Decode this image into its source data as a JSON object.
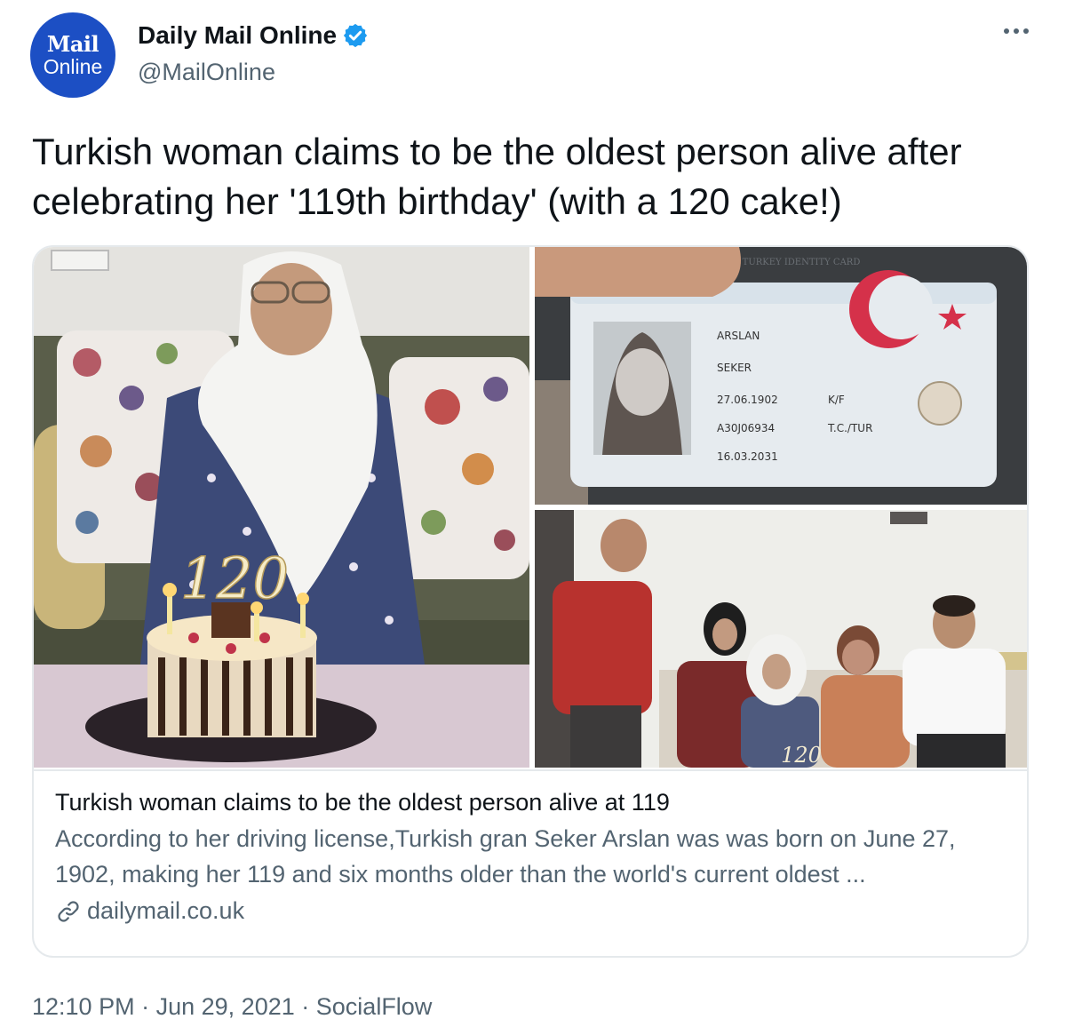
{
  "account": {
    "avatar_line1": "Mail",
    "avatar_line2": "Online",
    "name": "Daily Mail Online",
    "handle": "@MailOnline",
    "verified": true
  },
  "tweet": {
    "text": "Turkish woman claims to be the oldest person alive after celebrating her '119th birthday' (with a 120 cake!)"
  },
  "card": {
    "title": "Turkish woman claims to be the oldest person alive at 119",
    "description": "According to her driving license,Turkish gran Seker Arslan was was born on June 27, 1902, making her 119 and six months older than the world's current oldest ...",
    "domain": "dailymail.co.uk",
    "photos": [
      {
        "cake_number": "120"
      },
      {
        "card_header": "TURKEY IDENTITY CARD",
        "surname": "ARSLAN",
        "given_name": "SEKER",
        "birth_date": "27.06.1902",
        "sex": "K/F",
        "doc_number": "A30J06934",
        "nationality": "T.C./TUR",
        "valid_until": "16.03.2031"
      },
      {
        "cake_number": "120"
      }
    ]
  },
  "footer": {
    "time": "12:10 PM",
    "separator": "·",
    "date": "Jun 29, 2021",
    "source": "SocialFlow"
  },
  "colors": {
    "text": "#0f1419",
    "secondary": "#536471",
    "verified": "#1d9bf0",
    "avatar_bg": "#1c4fc4",
    "border": "#e5e9ec"
  },
  "icons": [
    "verified-badge-icon",
    "more-dots-icon",
    "link-icon"
  ]
}
